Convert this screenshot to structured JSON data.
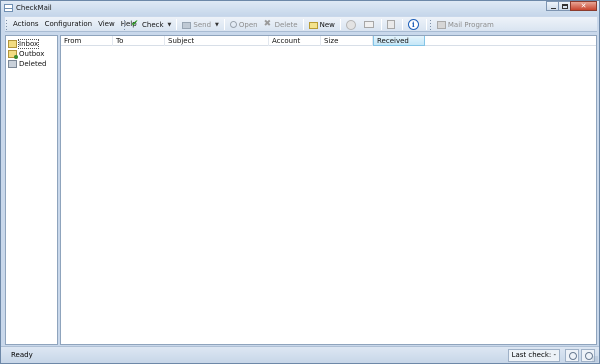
{
  "window": {
    "title": "CheckMail"
  },
  "menu": [
    "Actions",
    "Configuration",
    "View",
    "Help"
  ],
  "toolbar": {
    "check_label": "Check",
    "send_label": "Send",
    "open_label": "Open",
    "delete_label": "Delete",
    "new_label": "New",
    "mail_program_label": "Mail Program"
  },
  "folders": [
    {
      "label": "Inbox",
      "icon": "inbox-icon"
    },
    {
      "label": "Outbox",
      "icon": "outbox-icon"
    },
    {
      "label": "Deleted",
      "icon": "deleted-icon"
    }
  ],
  "columns": [
    "From",
    "To",
    "Subject",
    "Account",
    "Size",
    "Received"
  ],
  "status": {
    "text": "Ready",
    "last_check_label": "Last check: -"
  }
}
